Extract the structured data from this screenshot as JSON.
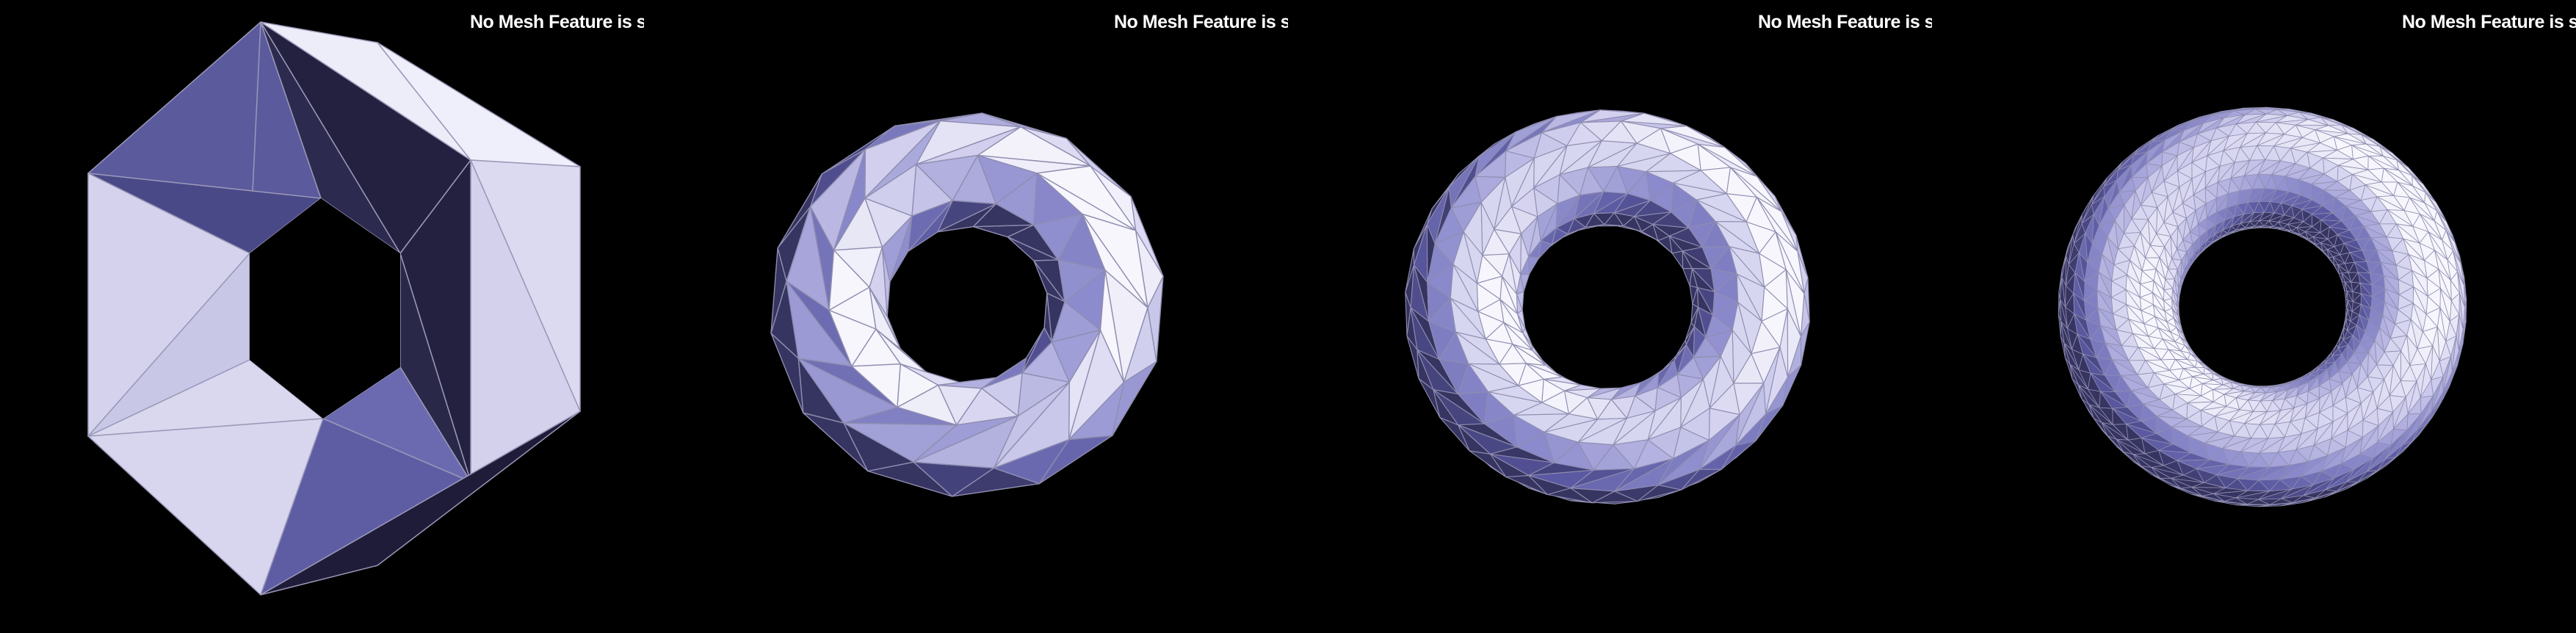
{
  "viewports": [
    {
      "status": "No Mesh Feature is selected",
      "mesh": "hexagonal-torus-coarse"
    },
    {
      "status": "No Mesh Feature is selected",
      "mesh": "torus-low-resolution"
    },
    {
      "status": "No Mesh Feature is selected",
      "mesh": "torus-medium-resolution"
    },
    {
      "status": "No Mesh Feature is selected",
      "mesh": "torus-high-resolution"
    }
  ],
  "colors": {
    "background": "#000000",
    "edge": "#9a98b8",
    "light": "#d8d6ee",
    "mid": "#8a89c8",
    "dark": "#5d5b9e",
    "shadow": "#23213f"
  }
}
